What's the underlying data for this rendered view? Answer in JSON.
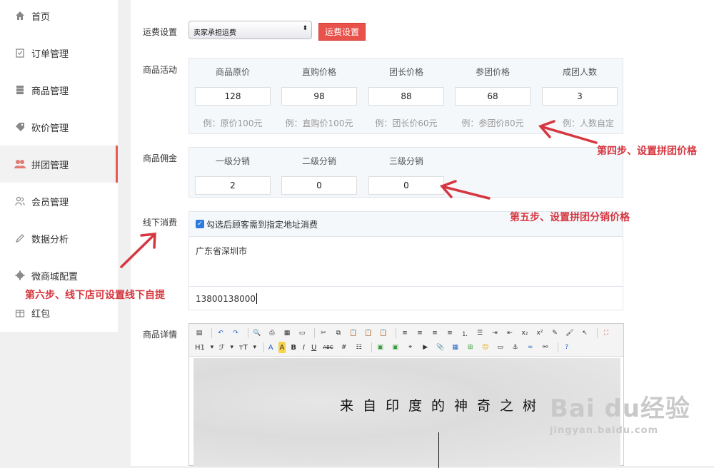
{
  "sidebar": {
    "items": [
      {
        "label": "首页",
        "icon": "home-icon"
      },
      {
        "label": "订单管理",
        "icon": "clipboard-icon"
      },
      {
        "label": "商品管理",
        "icon": "database-icon"
      },
      {
        "label": "砍价管理",
        "icon": "tag-icon"
      },
      {
        "label": "拼团管理",
        "icon": "group-icon"
      },
      {
        "label": "会员管理",
        "icon": "users-icon"
      },
      {
        "label": "数据分析",
        "icon": "pencil-icon"
      },
      {
        "label": "微商城配置",
        "icon": "gear-icon"
      },
      {
        "label": "红包",
        "icon": "gift-icon"
      }
    ],
    "active_index": 4
  },
  "shipping": {
    "label": "运费设置",
    "select_value": "卖家承担运费",
    "button_label": "运费设置"
  },
  "activity": {
    "label": "商品活动",
    "headers": [
      "商品原价",
      "直购价格",
      "团长价格",
      "参团价格",
      "成团人数"
    ],
    "values": [
      "128",
      "98",
      "88",
      "68",
      "3"
    ],
    "hints": [
      "例：原价100元",
      "例：直购价100元",
      "例：团长价60元",
      "例：参团价80元",
      "例：人数自定"
    ]
  },
  "commission": {
    "label": "商品佣金",
    "headers": [
      "一级分销",
      "二级分销",
      "三级分销"
    ],
    "values": [
      "2",
      "0",
      "0"
    ]
  },
  "offline": {
    "label": "线下消费",
    "checkbox_label": "勾选后顾客需到指定地址消费",
    "address": "广东省深圳市",
    "phone": "13800138000"
  },
  "detail": {
    "label": "商品详情",
    "toolbar": {
      "h1": "H1",
      "font": "ℱ",
      "size": "тT",
      "color_a": "A",
      "bold": "B",
      "italic": "I",
      "underline": "U",
      "abc": "ABC"
    },
    "image_title": "来自印度的神奇之树"
  },
  "annotations": {
    "step4": "第四步、设置拼团价格",
    "step5": "第五步、设置拼团分销价格",
    "step6": "第六步、线下店可设置线下自提"
  },
  "watermark": {
    "main": "Bai du经验",
    "sub": "jingyan.baidu.com"
  },
  "colors": {
    "accent_red": "#e9524a",
    "annotation_red": "#d6363f",
    "checkbox_blue": "#2e7be0"
  }
}
